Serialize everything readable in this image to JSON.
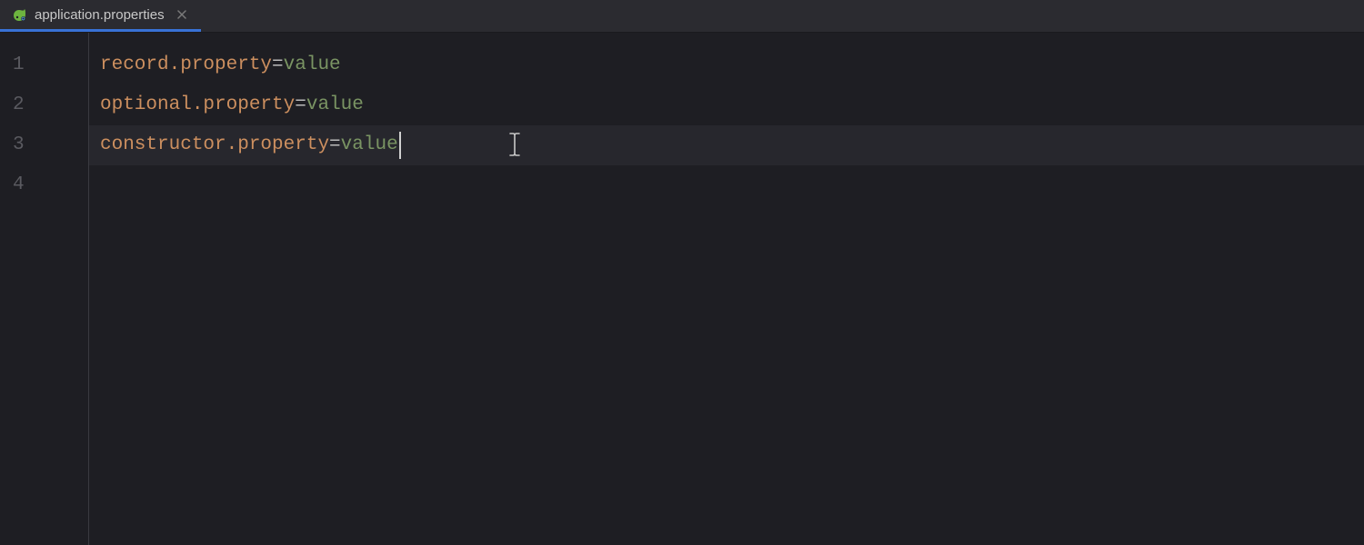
{
  "tab": {
    "label": "application.properties"
  },
  "editor": {
    "lines": [
      {
        "num": "1",
        "key": "record.property",
        "value": "value",
        "current": false
      },
      {
        "num": "2",
        "key": "optional.property",
        "value": "value",
        "current": false
      },
      {
        "num": "3",
        "key": "constructor.property",
        "value": "value",
        "current": true
      },
      {
        "num": "4",
        "key": "",
        "value": "",
        "current": false
      }
    ]
  },
  "colors": {
    "key": "#cc8f5f",
    "value": "#7a9463",
    "accent": "#3872d6",
    "background": "#1e1e23"
  }
}
